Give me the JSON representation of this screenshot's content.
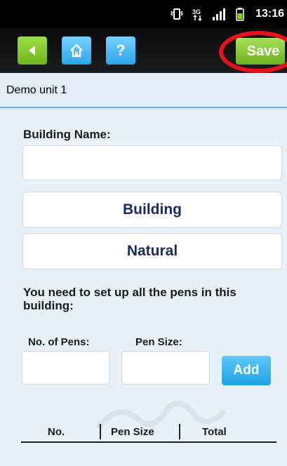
{
  "status_bar": {
    "time": "13:16",
    "icons": [
      "vibrate-icon",
      "network-3g-icon",
      "signal-icon",
      "battery-icon"
    ]
  },
  "toolbar": {
    "back_icon": "back-arrow-icon",
    "home_icon": "home-icon",
    "help_label": "?",
    "save_label": "Save",
    "colors": {
      "green": "#7fc32a",
      "blue": "#29a8ee",
      "highlight": "#e8101b"
    }
  },
  "header": {
    "title": "Demo unit 1"
  },
  "form": {
    "building_name_label": "Building Name:",
    "building_name_value": "",
    "building_button": "Building",
    "natural_button": "Natural",
    "info_text": "You need to set up all the pens in this building:",
    "pens_label": "No. of Pens:",
    "pens_value": "",
    "pen_size_label": "Pen Size:",
    "pen_size_value": "",
    "add_button": "Add"
  },
  "table": {
    "headers": [
      "No.",
      "Pen Size",
      "Total"
    ]
  }
}
